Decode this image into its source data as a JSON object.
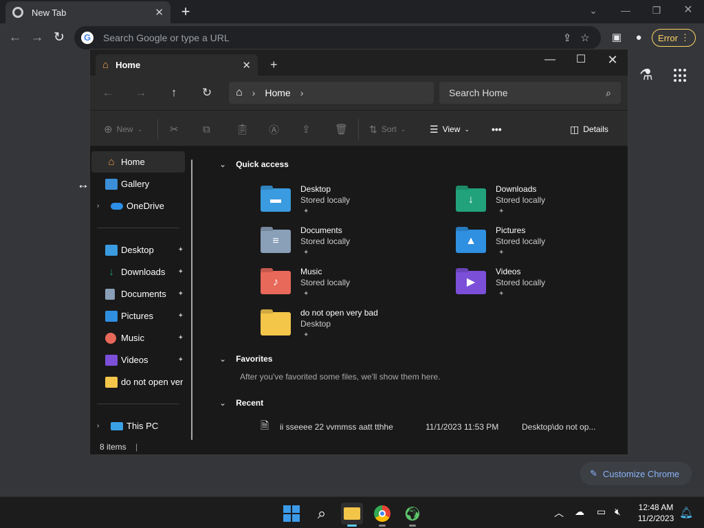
{
  "chrome": {
    "tab_title": "New Tab",
    "tab_close": "✕",
    "new_tab": "+",
    "omnibox_placeholder": "Search Google or type a URL",
    "google_letter": "G",
    "error_label": "Error",
    "customize_label": "Customize Chrome"
  },
  "explorer": {
    "tab_title": "Home",
    "tab_close": "✕",
    "new_tab": "+",
    "address": "Home",
    "search_placeholder": "Search Home",
    "commands": {
      "new": "New",
      "sort": "Sort",
      "view": "View",
      "more": "•••",
      "details": "Details"
    },
    "sidebar": {
      "home": "Home",
      "gallery": "Gallery",
      "onedrive": "OneDrive",
      "desktop": "Desktop",
      "downloads": "Downloads",
      "documents": "Documents",
      "pictures": "Pictures",
      "music": "Music",
      "videos": "Videos",
      "folder": "do not open ver",
      "this_pc": "This PC"
    },
    "sections": {
      "quick_access": "Quick access",
      "favorites": "Favorites",
      "favorites_empty": "After you've favorited some files, we'll show them here.",
      "recent": "Recent"
    },
    "quick_access": [
      {
        "name": "Desktop",
        "sub": "Stored locally",
        "color": "#3a9be0",
        "glyph": "▬"
      },
      {
        "name": "Downloads",
        "sub": "Stored locally",
        "color": "#21a27a",
        "glyph": "↓"
      },
      {
        "name": "Documents",
        "sub": "Stored locally",
        "color": "#8a9fb8",
        "glyph": "≡"
      },
      {
        "name": "Pictures",
        "sub": "Stored locally",
        "color": "#2f8fe0",
        "glyph": "▲"
      },
      {
        "name": "Music",
        "sub": "Stored locally",
        "color": "#e8685a",
        "glyph": "♪"
      },
      {
        "name": "Videos",
        "sub": "Stored locally",
        "color": "#7b4fd8",
        "glyph": "▶"
      },
      {
        "name": "do not open very bad",
        "sub": "Desktop",
        "color": "#f3c64a",
        "glyph": ""
      }
    ],
    "recent": [
      {
        "name": "ii  sseeee  22  vvmmss  aatt  tthhe",
        "date": "11/1/2023 11:53 PM",
        "location": "Desktop\\do not op..."
      }
    ],
    "status": "8 items"
  },
  "taskbar": {
    "time": "12:48 AM",
    "date": "11/2/2023"
  }
}
